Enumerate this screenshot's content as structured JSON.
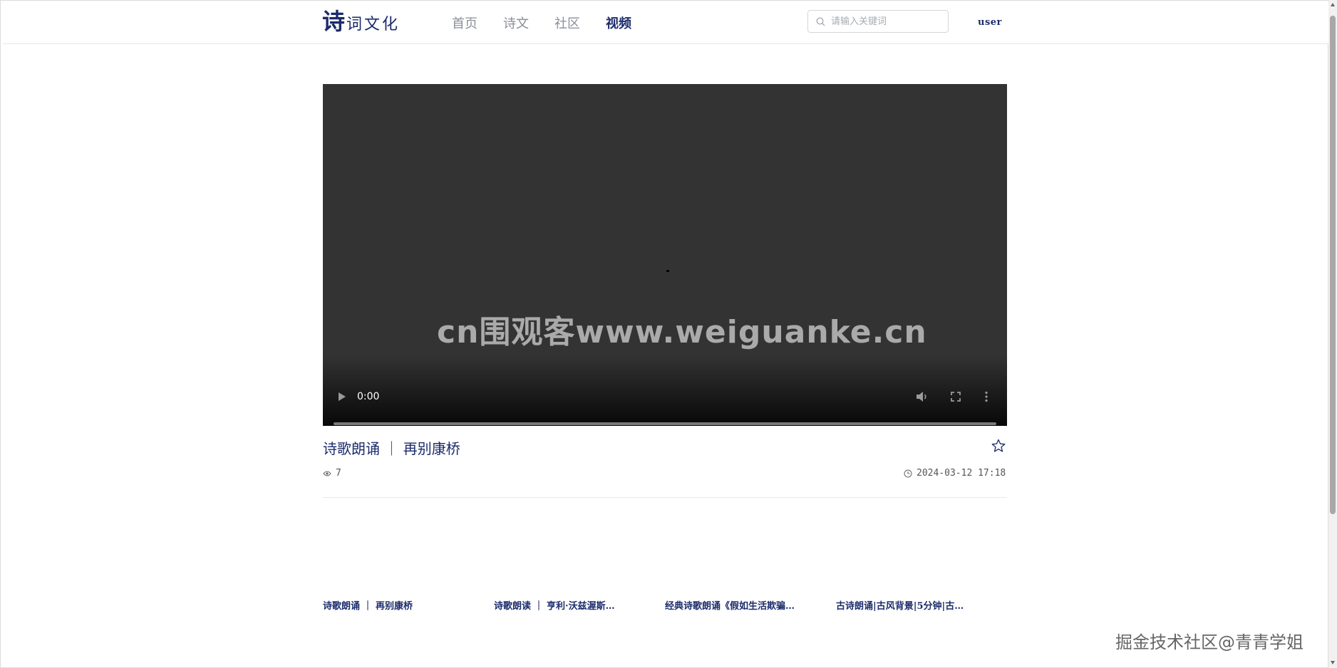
{
  "header": {
    "logo_big": "诗",
    "logo_rest": "词文化",
    "nav": [
      "首页",
      "诗文",
      "社区",
      "视频"
    ],
    "active_nav": "视频",
    "search_placeholder": "请输入关键词",
    "user": "user"
  },
  "video": {
    "time": "0:00",
    "progress": 0
  },
  "detail": {
    "title": "诗歌朗诵 ｜ 再别康桥",
    "views": "7",
    "date": "2024-03-12 17:18"
  },
  "related": [
    "诗歌朗诵 ｜ 再别康桥",
    "诗歌朗读 ｜ 亨利·沃兹渥斯…",
    "经典诗歌朗诵《假如生活欺骗…",
    "古诗朗诵|古风背景|5分钟|古…"
  ],
  "watermarks": {
    "center": "cn围观客www.weiguanke.cn",
    "bottom": "掘金技术社区@青青学姐"
  },
  "colors": {
    "brand": "#1b2b6b",
    "video_bg": "#333333"
  }
}
